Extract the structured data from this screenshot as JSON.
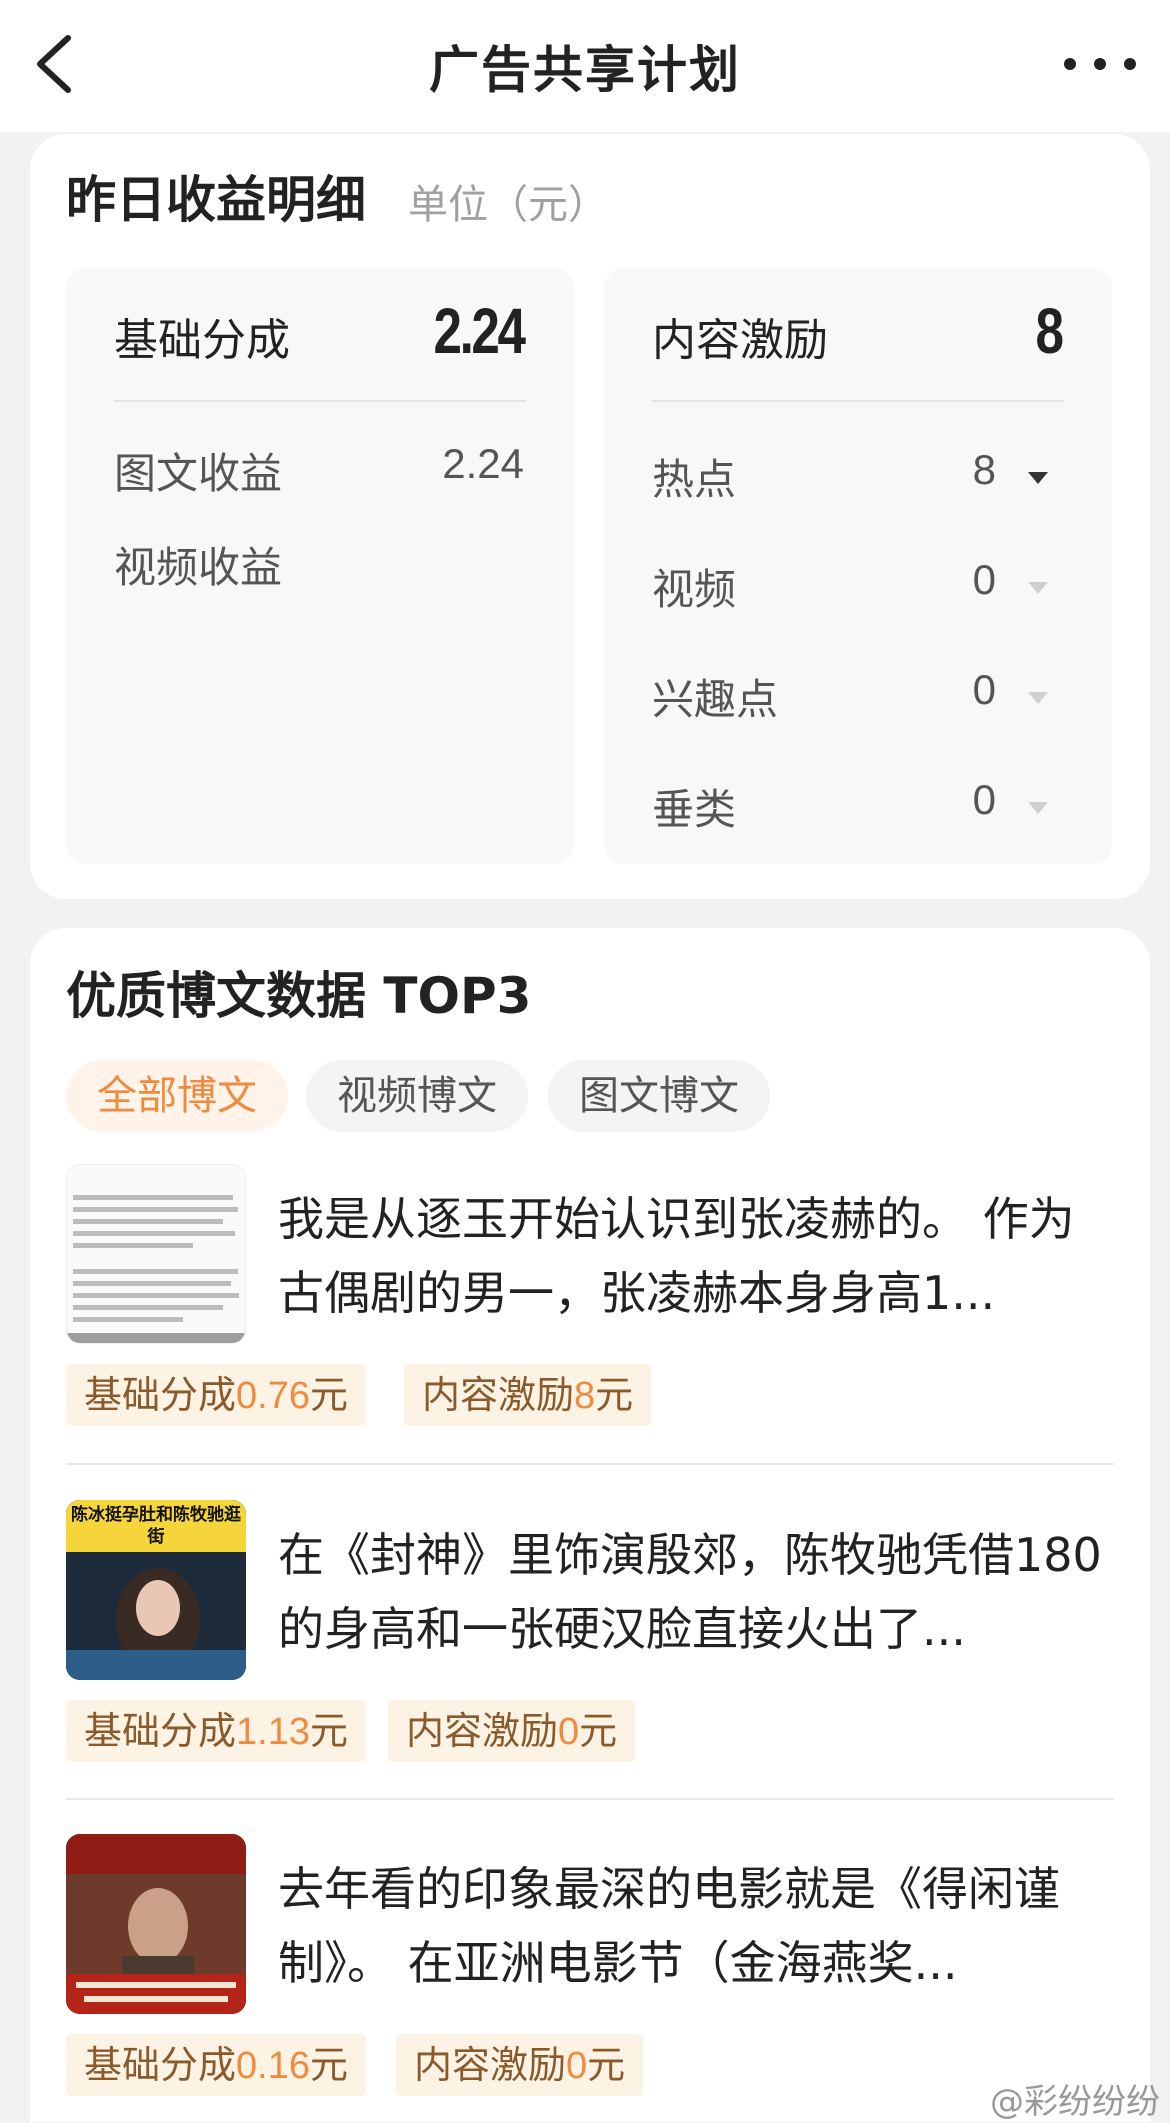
{
  "nav": {
    "title": "广告共享计划"
  },
  "earnings": {
    "title": "昨日收益明细",
    "unit": "单位（元）",
    "base": {
      "label": "基础分成",
      "value": "2.24",
      "rows": [
        {
          "label": "图文收益",
          "value": "2.24"
        },
        {
          "label": "视频收益",
          "value": ""
        }
      ]
    },
    "incentive": {
      "label": "内容激励",
      "value": "8",
      "rows": [
        {
          "label": "热点",
          "value": "8"
        },
        {
          "label": "视频",
          "value": "0"
        },
        {
          "label": "兴趣点",
          "value": "0"
        },
        {
          "label": "垂类",
          "value": "0"
        }
      ]
    }
  },
  "top_posts": {
    "title": "优质博文数据 TOP3",
    "tabs": [
      "全部博文",
      "视频博文",
      "图文博文"
    ],
    "posts": [
      {
        "text": "我是从逐玉开始认识到张凌赫的。 作为古偶剧的男一，张凌赫本身身高1...",
        "base_prefix": "基础分成",
        "base_num": "0.76",
        "base_suffix": "元",
        "inc_prefix": "内容激励",
        "inc_num": "8",
        "inc_suffix": "元"
      },
      {
        "text": "在《封神》里饰演殷郊，陈牧驰凭借180的身高和一张硬汉脸直接火出了...",
        "thumb_caption": "陈冰挺孕肚和陈牧驰逛街",
        "base_prefix": "基础分成",
        "base_num": "1.13",
        "base_suffix": "元",
        "inc_prefix": "内容激励",
        "inc_num": "0",
        "inc_suffix": "元"
      },
      {
        "text": "去年看的印象最深的电影就是《得闲谨制》。 在亚洲电影节（金海燕奖...",
        "base_prefix": "基础分成",
        "base_num": "0.16",
        "base_suffix": "元",
        "inc_prefix": "内容激励",
        "inc_num": "0",
        "inc_suffix": "元"
      }
    ]
  },
  "watermark": "@彩纷纷纷",
  "colors": {
    "accent": "#f08a3c",
    "tag_bg": "#fdf3e5",
    "page_bg": "#f2f2f2"
  }
}
